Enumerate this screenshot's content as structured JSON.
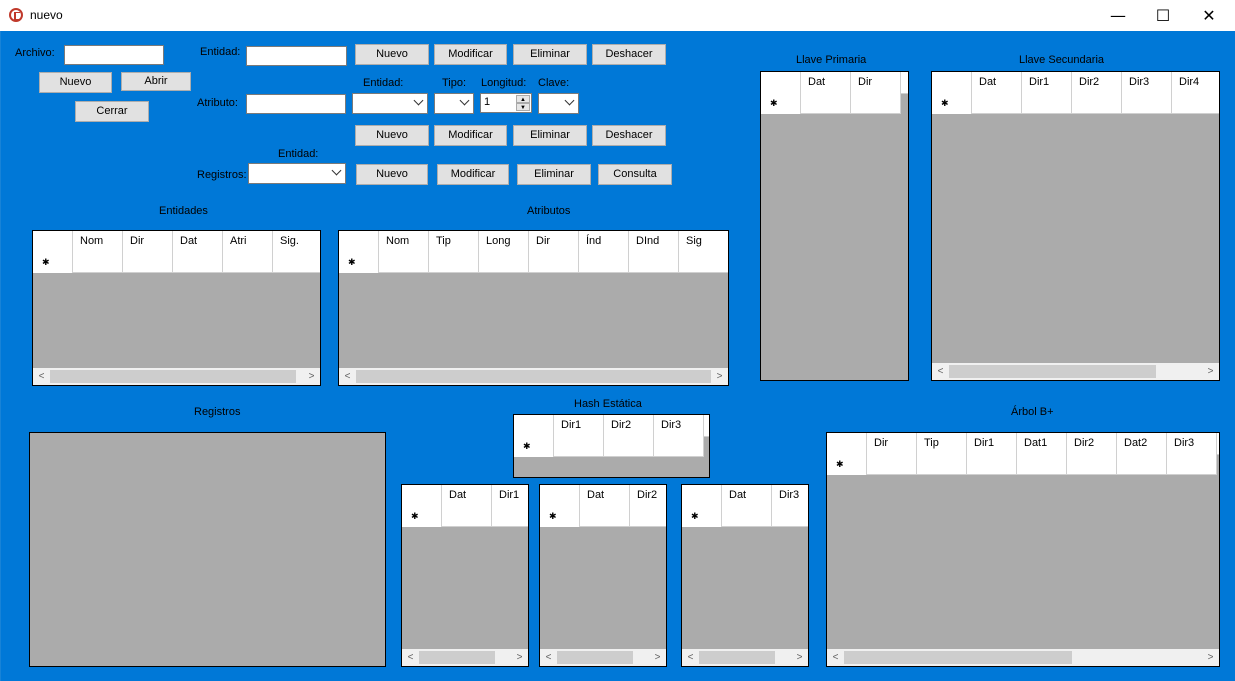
{
  "window": {
    "title": "nuevo",
    "minimize": "—",
    "maximize": "☐",
    "close": "✕"
  },
  "file": {
    "label": "Archivo:",
    "value": "",
    "new": "Nuevo",
    "open": "Abrir",
    "close": "Cerrar"
  },
  "entity": {
    "label": "Entidad:",
    "value": "",
    "new": "Nuevo",
    "modify": "Modificar",
    "delete": "Eliminar",
    "undo": "Deshacer"
  },
  "attribute": {
    "label": "Atributo:",
    "value": "",
    "entity_label": "Entidad:",
    "type_label": "Tipo:",
    "length_label": "Longitud:",
    "key_label": "Clave:",
    "length_value": "1",
    "new": "Nuevo",
    "modify": "Modificar",
    "delete": "Eliminar",
    "undo": "Deshacer"
  },
  "records_ctrl": {
    "label": "Registros:",
    "entity_label": "Entidad:",
    "new": "Nuevo",
    "modify": "Modificar",
    "delete": "Eliminar",
    "query": "Consulta"
  },
  "entities_grid": {
    "title": "Entidades",
    "columns": [
      "Nom",
      "Dir",
      "Dat",
      "Atri",
      "Sig."
    ]
  },
  "attributes_grid": {
    "title": "Atributos",
    "columns": [
      "Nom",
      "Tip",
      "Long",
      "Dir",
      "Índ",
      "DInd",
      "Sig"
    ]
  },
  "primary_key": {
    "title": "Llave Primaria",
    "columns": [
      "Dat",
      "Dir"
    ]
  },
  "secondary_key": {
    "title": "Llave Secundaria",
    "columns": [
      "Dat",
      "Dir1",
      "Dir2",
      "Dir3",
      "Dir4"
    ]
  },
  "records_panel": {
    "title": "Registros"
  },
  "hash": {
    "title": "Hash Estática",
    "columns": [
      "Dir1",
      "Dir2",
      "Dir3"
    ]
  },
  "hash_buckets": [
    {
      "columns": [
        "Dat",
        "Dir1"
      ]
    },
    {
      "columns": [
        "Dat",
        "Dir2"
      ]
    },
    {
      "columns": [
        "Dat",
        "Dir3"
      ]
    }
  ],
  "bplus": {
    "title": "Árbol B+",
    "columns": [
      "Dir",
      "Tip",
      "Dir1",
      "Dat1",
      "Dir2",
      "Dat2",
      "Dir3"
    ]
  },
  "new_row_marker": "✱",
  "scroll": {
    "left": "<",
    "right": ">"
  }
}
